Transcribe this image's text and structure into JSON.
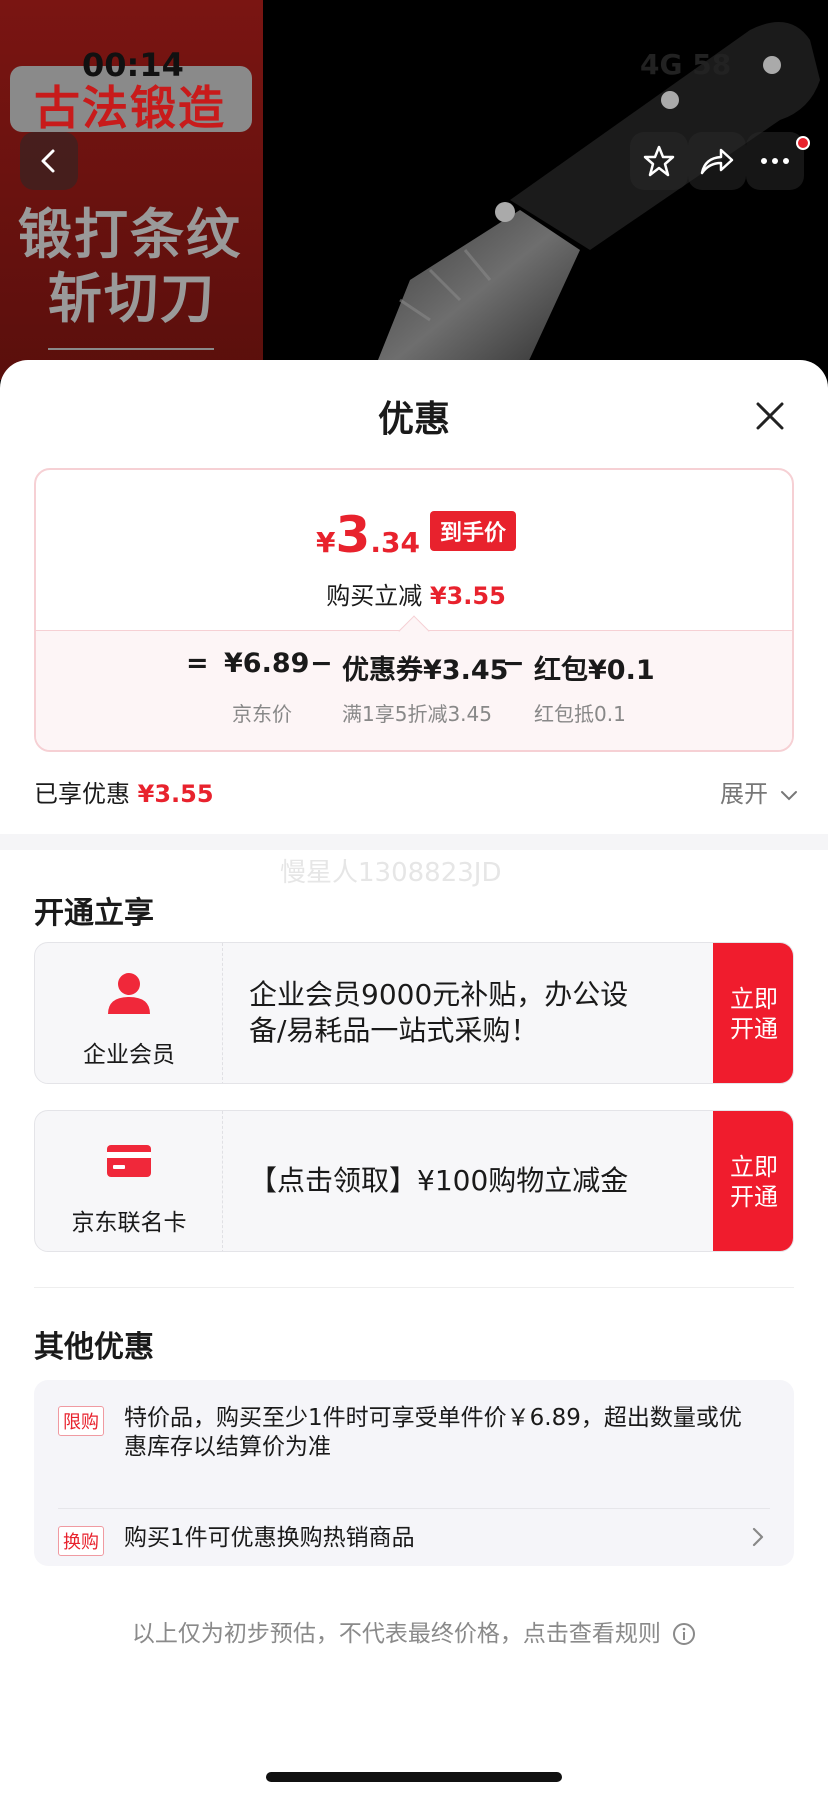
{
  "status_bar": {
    "time": "00:14",
    "right": "4G  58"
  },
  "hero": {
    "badge": "古法锻造",
    "line1": "锻打条纹",
    "line2": "斩切刀"
  },
  "sheet": {
    "title": "优惠",
    "price": {
      "yen": "¥",
      "integer": "3",
      "decimal": ".34",
      "tag": "到手价",
      "sub_label": "购买立减",
      "sub_value": "¥3.55"
    },
    "formula": {
      "equals": "=",
      "jd_price": "¥6.89",
      "minus1": "−",
      "coupon": "优惠券¥3.45",
      "minus2": "−",
      "redpack": "红包¥0.1",
      "jd_price_label": "京东价",
      "coupon_label": "满1享5折减3.45",
      "redpack_label": "红包抵0.1"
    },
    "enjoyed_label": "已享优惠",
    "enjoyed_value": "¥3.55",
    "expand_label": "展开",
    "watermark": "慢星人1308823JD",
    "open_section_title": "开通立享",
    "promos": [
      {
        "name": "企业会员",
        "text": "企业会员9000元补贴，办公设备/易耗品一站式采购！",
        "button": "立即\n开通",
        "btn1": "立即",
        "btn2": "开通"
      },
      {
        "name": "京东联名卡",
        "text": "【点击领取】¥100购物立减金",
        "btn1": "立即",
        "btn2": "开通"
      }
    ],
    "other_section_title": "其他优惠",
    "others": [
      {
        "tag": "限购",
        "text": "特价品，购买至少1件时可享受单件价￥6.89，超出数量或优惠库存以结算价为准"
      },
      {
        "tag": "换购",
        "text": "购买1件可优惠换购热销商品"
      }
    ],
    "footnote": "以上仅为初步预估，不代表最终价格，点击查看规则"
  },
  "colors": {
    "accent": "#e8222d",
    "button_red": "#f01c2d"
  }
}
